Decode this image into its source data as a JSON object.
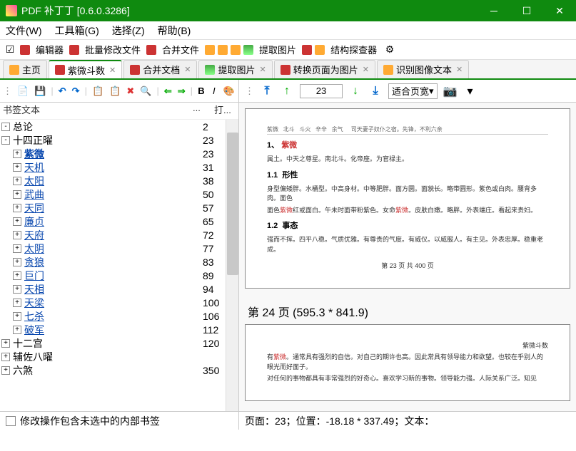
{
  "title": "PDF 补丁丁 [0.6.0.3286]",
  "menu": {
    "file": "文件(W)",
    "toolbox": "工具箱(G)",
    "select": "选择(Z)",
    "help": "帮助(B)"
  },
  "toolbar1": {
    "editor": "编辑器",
    "batch": "批量修改文件",
    "merge": "合并文件",
    "extract": "提取图片",
    "inspector": "结构探查器"
  },
  "tabs": [
    {
      "label": "主页",
      "active": false
    },
    {
      "label": "紫微斗数",
      "active": true
    },
    {
      "label": "合并文档",
      "active": false
    },
    {
      "label": "提取图片",
      "active": false
    },
    {
      "label": "转换页面为图片",
      "active": false
    },
    {
      "label": "识别图像文本",
      "active": false
    }
  ],
  "tree_header": {
    "col1": "书签文本",
    "col2": "... ",
    "col3": "打..."
  },
  "bookmarks": [
    {
      "label": "总论",
      "page": "2",
      "level": 0,
      "toggle": "-",
      "link": false
    },
    {
      "label": "十四正曜",
      "page": "23",
      "level": 0,
      "toggle": "-",
      "link": false
    },
    {
      "label": "紫微",
      "page": "23",
      "level": 1,
      "toggle": "+",
      "link": true,
      "bold": true
    },
    {
      "label": "天机",
      "page": "31",
      "level": 1,
      "toggle": "+",
      "link": true
    },
    {
      "label": "太阳",
      "page": "38",
      "level": 1,
      "toggle": "+",
      "link": true
    },
    {
      "label": "武曲",
      "page": "50",
      "level": 1,
      "toggle": "+",
      "link": true
    },
    {
      "label": "天同",
      "page": "57",
      "level": 1,
      "toggle": "+",
      "link": true
    },
    {
      "label": "廉贞",
      "page": "65",
      "level": 1,
      "toggle": "+",
      "link": true
    },
    {
      "label": "天府",
      "page": "72",
      "level": 1,
      "toggle": "+",
      "link": true
    },
    {
      "label": "太阴",
      "page": "77",
      "level": 1,
      "toggle": "+",
      "link": true
    },
    {
      "label": "贪狼",
      "page": "83",
      "level": 1,
      "toggle": "+",
      "link": true
    },
    {
      "label": "巨门",
      "page": "89",
      "level": 1,
      "toggle": "+",
      "link": true
    },
    {
      "label": "天相",
      "page": "94",
      "level": 1,
      "toggle": "+",
      "link": true
    },
    {
      "label": "天梁",
      "page": "100",
      "level": 1,
      "toggle": "+",
      "link": true
    },
    {
      "label": "七杀",
      "page": "106",
      "level": 1,
      "toggle": "+",
      "link": true
    },
    {
      "label": "破军",
      "page": "112",
      "level": 1,
      "toggle": "+",
      "link": true
    },
    {
      "label": "十二宫",
      "page": "120",
      "level": 0,
      "toggle": "+",
      "link": false
    },
    {
      "label": "辅佐八曜",
      "page": "",
      "level": 0,
      "toggle": "+",
      "link": false
    },
    {
      "label": "六煞",
      "page": "350",
      "level": 0,
      "toggle": "+",
      "link": false
    }
  ],
  "checkbox_label": "修改操作包含未选中的内部书签",
  "right_toolbar": {
    "page": "23",
    "zoom": "适合页宽"
  },
  "preview": {
    "sec1_num": "1、",
    "sec1_title": "紫微",
    "sec1_body": "属土。中天之尊星。南北斗。化帝座。为官禄主。",
    "sec11_num": "1.1",
    "sec11_title": "形性",
    "sec11_body": "身型偏矮胖。水桶型。中高身材。中等肥胖。面方圆。面貌长。略带圆形。紫色或白肉。腰背多肉。面色",
    "sec12_num": "1.2",
    "sec12_title": "事态",
    "sec12_body": "强而不挥。四平八稳。气质优雅。有尊贵的气度。有威仪。以威服人。有主见。外表忠厚。稳重老成。",
    "page23_footer": "第 23 页 共 400 页",
    "page24_label": "第 24 页 (595.3 * 841.9)",
    "page24_header": "紫微斗数"
  },
  "status": "页面：23；位置：-18.18 * 337.49；文本："
}
